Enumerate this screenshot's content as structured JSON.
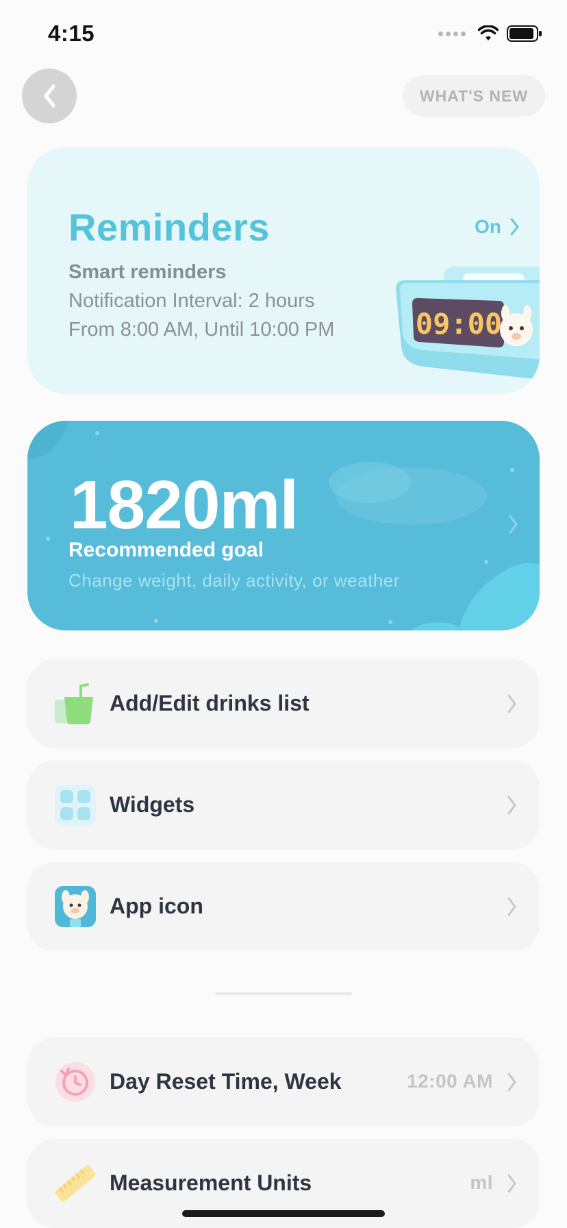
{
  "status_bar": {
    "time": "4:15"
  },
  "header": {
    "whats_new_label": "WHAT'S NEW"
  },
  "reminders": {
    "title": "Reminders",
    "status": "On",
    "mode": "Smart reminders",
    "interval": "Notification Interval: 2 hours",
    "schedule": "From 8:00 AM, Until 10:00 PM",
    "clock_display": "09:00"
  },
  "goal": {
    "value": "1820ml",
    "label": "Recommended goal",
    "subtitle": "Change weight, daily activity, or weather"
  },
  "menu": [
    {
      "label": "Add/Edit drinks list",
      "icon": "drink-cup-icon"
    },
    {
      "label": "Widgets",
      "icon": "widgets-grid-icon"
    },
    {
      "label": "App icon",
      "icon": "alpaca-app-icon"
    }
  ],
  "settings": [
    {
      "label": "Day Reset Time, Week",
      "value": "12:00 AM",
      "icon": "reset-clock-icon"
    },
    {
      "label": "Measurement Units",
      "value": "ml",
      "icon": "ruler-icon"
    }
  ],
  "colors": {
    "accent": "#55c3da",
    "goal_card": "#56bcd9",
    "reminders_card": "#e6f7f9",
    "row_bg": "#f4f4f4"
  }
}
